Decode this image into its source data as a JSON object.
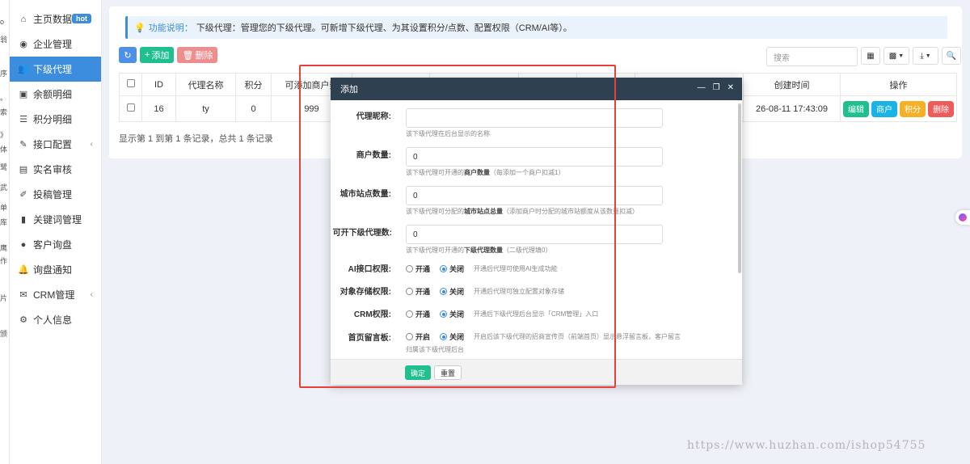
{
  "strip_labels": [
    "o",
    "翁",
    "序",
    "。",
    "索",
    "》",
    "体",
    "鹭",
    "武",
    "单",
    "库",
    "鹰",
    "作",
    "片",
    "颁"
  ],
  "sidebar": {
    "items": [
      {
        "label": "主页数据",
        "icon": "home-icon",
        "badge": "hot"
      },
      {
        "label": "企业管理",
        "icon": "user-circle-icon"
      },
      {
        "label": "下级代理",
        "icon": "users-icon",
        "active": true
      },
      {
        "label": "余额明细",
        "icon": "wallet-icon"
      },
      {
        "label": "积分明细",
        "icon": "list-card-icon"
      },
      {
        "label": "接口配置",
        "icon": "wrench-icon",
        "expandable": true
      },
      {
        "label": "实名审核",
        "icon": "id-card-icon"
      },
      {
        "label": "投稿管理",
        "icon": "edit-icon"
      },
      {
        "label": "关键词管理",
        "icon": "book-icon"
      },
      {
        "label": "客户询盘",
        "icon": "chat-icon"
      },
      {
        "label": "询盘通知",
        "icon": "bell-icon"
      },
      {
        "label": "CRM管理",
        "icon": "envelope-icon",
        "expandable": true
      },
      {
        "label": "个人信息",
        "icon": "gear-icon"
      }
    ]
  },
  "tip": {
    "prefix": "功能说明：",
    "text": "下级代理：管理您的下级代理。可新增下级代理、为其设置积分/点数、配置权限（CRM/AI等）。"
  },
  "toolbar": {
    "add_label": "添加",
    "delete_label": "删除",
    "search_placeholder": "搜索"
  },
  "table": {
    "headers": [
      "ID",
      "代理名称",
      "积分",
      "可添加商户数",
      "创建时间",
      "操作"
    ],
    "rows": [
      {
        "id": "16",
        "name": "ty",
        "score": "0",
        "merchants": "999",
        "created": "26-08-11 17:43:09"
      }
    ],
    "ops": [
      "编辑",
      "商户",
      "积分",
      "删除"
    ]
  },
  "summary": "显示第 1 到第 1 条记录，总共 1 条记录",
  "modal": {
    "title": "添加",
    "fields": {
      "nickname": {
        "label": "代理昵称:",
        "value": "",
        "help": "该下级代理在后台显示的名称"
      },
      "merchant_count": {
        "label": "商户数量:",
        "value": "0",
        "help_pre": "该下级代理可开通的",
        "help_bold": "商户数量",
        "help_post": "（每添加一个商户扣减1）"
      },
      "city_sites": {
        "label": "城市站点数量:",
        "value": "0",
        "help_pre": "该下级代理可分配的",
        "help_bold": "城市站点总量",
        "help_post": "（添加商户时分配的城市站额度从该数量扣减）"
      },
      "sub_agents": {
        "label": "可开下级代理数:",
        "value": "0",
        "help_pre": "该下级代理可开通的",
        "help_bold": "下级代理数量",
        "help_post": "（二级代理填0）"
      }
    },
    "radios": {
      "ai": {
        "label": "AI接口权限:",
        "on": "开通",
        "off": "关闭",
        "hint": "开通后代理可使用AI生成功能"
      },
      "storage": {
        "label": "对象存储权限:",
        "on": "开通",
        "off": "关闭",
        "hint": "开通后代理可独立配置对象存储"
      },
      "crm": {
        "label": "CRM权限:",
        "on": "开通",
        "off": "关闭",
        "hint": "开通后下级代理后台显示「CRM管理」入口"
      },
      "guestbook": {
        "label": "首页留言板:",
        "on": "开启",
        "off": "关闭",
        "hint": "开启后该下级代理的招商宣传页（前端首页）显示悬浮留言板，客户留言",
        "hint2": "归属该下级代理后台"
      }
    },
    "confirm_label": "确定",
    "reset_label": "重置"
  },
  "watermark": "https://www.huzhan.com/ishop54755"
}
